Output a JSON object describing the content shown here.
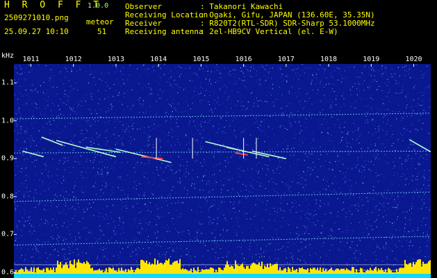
{
  "header": {
    "app_title": "H R O F F T",
    "version": "1.0.0",
    "filename": "2509271010.png",
    "meteor_label": "meteor",
    "datetime": "25.09.27 10:10",
    "meteor_count": "51",
    "info": [
      {
        "label": "Observer",
        "value": ": Takanori Kawachi"
      },
      {
        "label": "Receiving Location",
        "value": ": Ogaki, Gifu, JAPAN (136.60E, 35.35N)"
      },
      {
        "label": "Receiver",
        "value": ": R820T2(RTL-SDR) SDR-Sharp 53.1000MHz"
      },
      {
        "label": "Receiving antenna",
        "value": ": 2el-HB9CV Vertical (el. E-W)"
      }
    ]
  },
  "colors": {
    "background": "#000000",
    "spectrogram_base": "#0a1890",
    "signal": "#7cf2ff",
    "hot_signal": "#ff4040",
    "histogram": "#ffe600",
    "histogram_base": "#10d8ff",
    "grid": "#ffffff",
    "header_text": "#ffff00",
    "version_text": "#9cff9c"
  },
  "chart_data": {
    "type": "heatmap",
    "y_unit": "kHz",
    "x_ticks": [
      "1011",
      "1012",
      "1013",
      "1014",
      "1015",
      "1016",
      "1017",
      "1018",
      "1019",
      "1020"
    ],
    "y_ticks": [
      "1.1",
      "1.0",
      "0.9",
      "0.8",
      "0.7",
      "0.6"
    ],
    "xlim": [
      1010.6,
      1020.4
    ],
    "ylim": [
      0.585,
      1.15
    ],
    "carrier_traces": [
      {
        "from": [
          1010.6,
          0.915
        ],
        "to": [
          1020.4,
          0.92
        ]
      },
      {
        "from": [
          1010.6,
          0.787
        ],
        "to": [
          1020.4,
          0.812
        ]
      },
      {
        "from": [
          1010.6,
          0.672
        ],
        "to": [
          1020.4,
          0.695
        ]
      },
      {
        "from": [
          1010.6,
          1.005
        ],
        "to": [
          1020.4,
          1.02
        ]
      }
    ],
    "meteor_streaks": [
      {
        "from": [
          1011.25,
          0.957
        ],
        "to": [
          1011.75,
          0.935
        ]
      },
      {
        "from": [
          1011.6,
          0.948
        ],
        "to": [
          1013.0,
          0.905
        ]
      },
      {
        "from": [
          1012.3,
          0.93
        ],
        "to": [
          1013.1,
          0.917
        ]
      },
      {
        "from": [
          1013.0,
          0.925
        ],
        "to": [
          1014.3,
          0.89
        ]
      },
      {
        "from": [
          1015.1,
          0.945
        ],
        "to": [
          1016.0,
          0.92
        ]
      },
      {
        "from": [
          1015.6,
          0.93
        ],
        "to": [
          1016.6,
          0.905
        ]
      },
      {
        "from": [
          1016.2,
          0.92
        ],
        "to": [
          1017.0,
          0.9
        ]
      },
      {
        "from": [
          1019.9,
          0.95
        ],
        "to": [
          1020.4,
          0.918
        ]
      },
      {
        "from": [
          1010.8,
          0.92
        ],
        "to": [
          1011.3,
          0.905
        ]
      }
    ],
    "vertical_spikes": [
      1013.95,
      1014.8,
      1016.0,
      1016.3
    ],
    "reference_lines": [
      0.62,
      0.605
    ]
  }
}
